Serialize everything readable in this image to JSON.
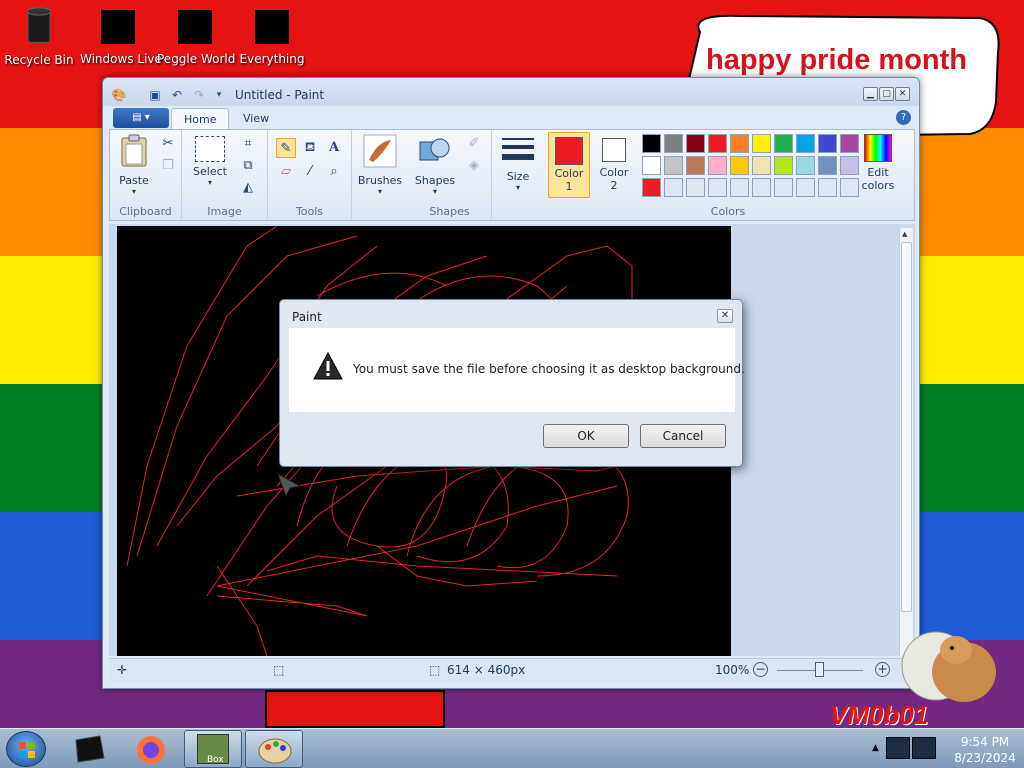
{
  "desktop": {
    "icons": [
      {
        "label": "Recycle Bin"
      },
      {
        "label": "Windows Live"
      },
      {
        "label": "Peggle World"
      },
      {
        "label": "Everything"
      }
    ],
    "speech_bubble": "happy pride month",
    "watermark": "VM0b01",
    "stripe_colors": [
      "#e61313",
      "#ff8c00",
      "#ffed00",
      "#008026",
      "#1e5cd8",
      "#732982"
    ]
  },
  "paint": {
    "title": "Untitled - Paint",
    "tabs": [
      {
        "label": "Home"
      },
      {
        "label": "View"
      }
    ],
    "groups": {
      "clipboard": "Clipboard",
      "image": "Image",
      "tools": "Tools",
      "shapes": "Shapes",
      "colors": "Colors"
    },
    "buttons": {
      "paste": "Paste",
      "select": "Select",
      "brushes": "Brushes",
      "shapes": "Shapes",
      "size": "Size",
      "color1": "Color",
      "color1_num": "1",
      "color2": "Color",
      "color2_num": "2",
      "edit_colors": "Edit",
      "edit_colors_2": "colors"
    },
    "palette_row1": [
      "#000000",
      "#7f7f7f",
      "#880015",
      "#ed1c24",
      "#ff7f27",
      "#fff200",
      "#22b14c",
      "#00a2e8",
      "#3f48cc",
      "#a349a4"
    ],
    "palette_row2": [
      "#ffffff",
      "#c3c3c3",
      "#b97a57",
      "#ffaec9",
      "#ffc90e",
      "#efe4b0",
      "#b5e61d",
      "#99d9ea",
      "#7092be",
      "#c8bfe7"
    ],
    "palette_row3": [
      "#ed1c24",
      "#dde6f0",
      "#dde6f0",
      "#dde6f0",
      "#dde6f0",
      "#dde6f0",
      "#dde6f0",
      "#dde6f0",
      "#dde6f0",
      "#dde6f0"
    ],
    "color1_value": "#ed1c24",
    "color2_value": "#ffffff",
    "status": {
      "canvas_size": "614 × 460px",
      "zoom": "100%",
      "zoom_level": 1.0
    }
  },
  "dialog": {
    "title": "Paint",
    "message": "You must save the file before choosing it as desktop background.",
    "ok": "OK",
    "cancel": "Cancel"
  },
  "taskbar": {
    "time": "9:54 PM",
    "date": "8/23/2024",
    "box_label": "Box"
  }
}
